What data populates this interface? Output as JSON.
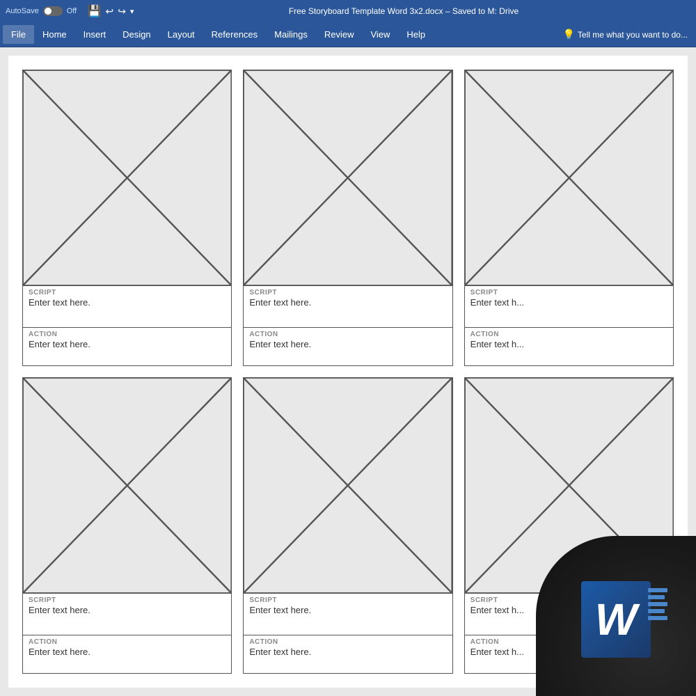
{
  "titlebar": {
    "autosave": "AutoSave",
    "off_label": "Off",
    "title": "Free Storyboard Template Word 3x2.docx  –  Saved to M: Drive"
  },
  "ribbon": {
    "tabs": [
      "File",
      "Home",
      "Insert",
      "Design",
      "Layout",
      "References",
      "Mailings",
      "Review",
      "View",
      "Help"
    ],
    "tell_me": "Tell me what you want to do..."
  },
  "storyboard": {
    "cells": [
      {
        "script_label": "SCRIPT",
        "script_text": "Enter text here.",
        "action_label": "ACTION",
        "action_text": "Enter text here."
      },
      {
        "script_label": "SCRIPT",
        "script_text": "Enter text here.",
        "action_label": "ACTION",
        "action_text": "Enter text here."
      },
      {
        "script_label": "SCRIPT",
        "script_text": "Enter text h...",
        "action_label": "ACTION",
        "action_text": "Enter text h..."
      },
      {
        "script_label": "SCRIPT",
        "script_text": "Enter text here.",
        "action_label": "ACTION",
        "action_text": "Enter text here."
      },
      {
        "script_label": "SCRIPT",
        "script_text": "Enter text here.",
        "action_label": "ACTION",
        "action_text": "Enter text here."
      },
      {
        "script_label": "SCRIPT",
        "script_text": "Enter text h...",
        "action_label": "ACTION",
        "action_text": "Enter text h..."
      }
    ]
  },
  "word_logo": {
    "letter": "W"
  }
}
